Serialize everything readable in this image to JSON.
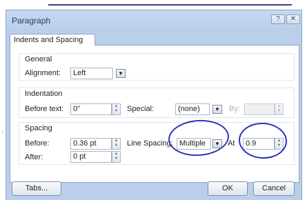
{
  "window": {
    "title": "Paragraph",
    "help_glyph": "?",
    "close_glyph": "✕"
  },
  "tabs": [
    {
      "label": "Indents and Spacing",
      "selected": true
    }
  ],
  "general": {
    "heading": "General",
    "alignment_label": "Alignment:",
    "alignment_value": "Left"
  },
  "indentation": {
    "heading": "Indentation",
    "before_text_label": "Before text:",
    "before_text_value": "0\"",
    "special_label": "Special:",
    "special_value": "(none)",
    "by_label": "By:",
    "by_value": ""
  },
  "spacing": {
    "heading": "Spacing",
    "before_label": "Before:",
    "before_value": "0.36 pt",
    "after_label": "After:",
    "after_value": "0 pt",
    "line_spacing_label": "Line Spacing:",
    "line_spacing_value": "Multiple",
    "at_label": "At",
    "at_value": "0.9"
  },
  "buttons": {
    "tabs": "Tabs...",
    "ok": "OK",
    "cancel": "Cancel"
  },
  "colors": {
    "dialog_frame": "#b9cfea",
    "annotation_ink": "#2a33b8"
  }
}
